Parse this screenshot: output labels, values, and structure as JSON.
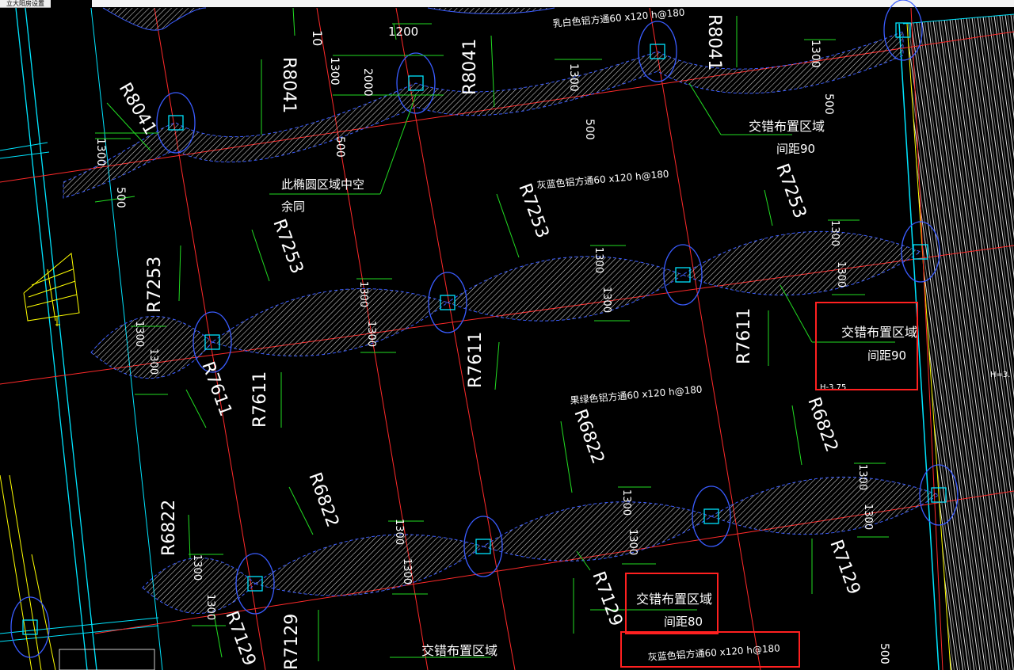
{
  "window": {
    "title_fragment": "立大阳房设置"
  },
  "colors": {
    "background": "#000000",
    "axis_red": "#ff2a2a",
    "dim_green": "#22dd22",
    "wall_cyan": "#00e5ff",
    "column_blue": "#3a5cff",
    "hatch_white": "#d8d8d8",
    "text_white": "#ffffff",
    "highlight_red": "#ff2020",
    "wall_yellow": "#ffff00"
  },
  "labels": {
    "r8041": "R8041",
    "r7253": "R7253",
    "r7611": "R7611",
    "r6822": "R6822",
    "r7129": "R7129",
    "d1300": "1300",
    "d2000": "2000",
    "d1200": "1200",
    "d500": "500",
    "d10": "10",
    "spec_milk": "乳白色铝方通60 x120 h@180",
    "spec_grey": "灰蓝色铝方通60 x120 h@180",
    "spec_green": "果绿色铝方通60 x120 h@180",
    "zone": "交错布置区域",
    "spacing90": "间距90",
    "spacing80": "间距80",
    "hollow_note": "此椭圆区域中空",
    "rest_same": "余同",
    "elev_375": "H-3.75",
    "elev_right": "H=3."
  }
}
